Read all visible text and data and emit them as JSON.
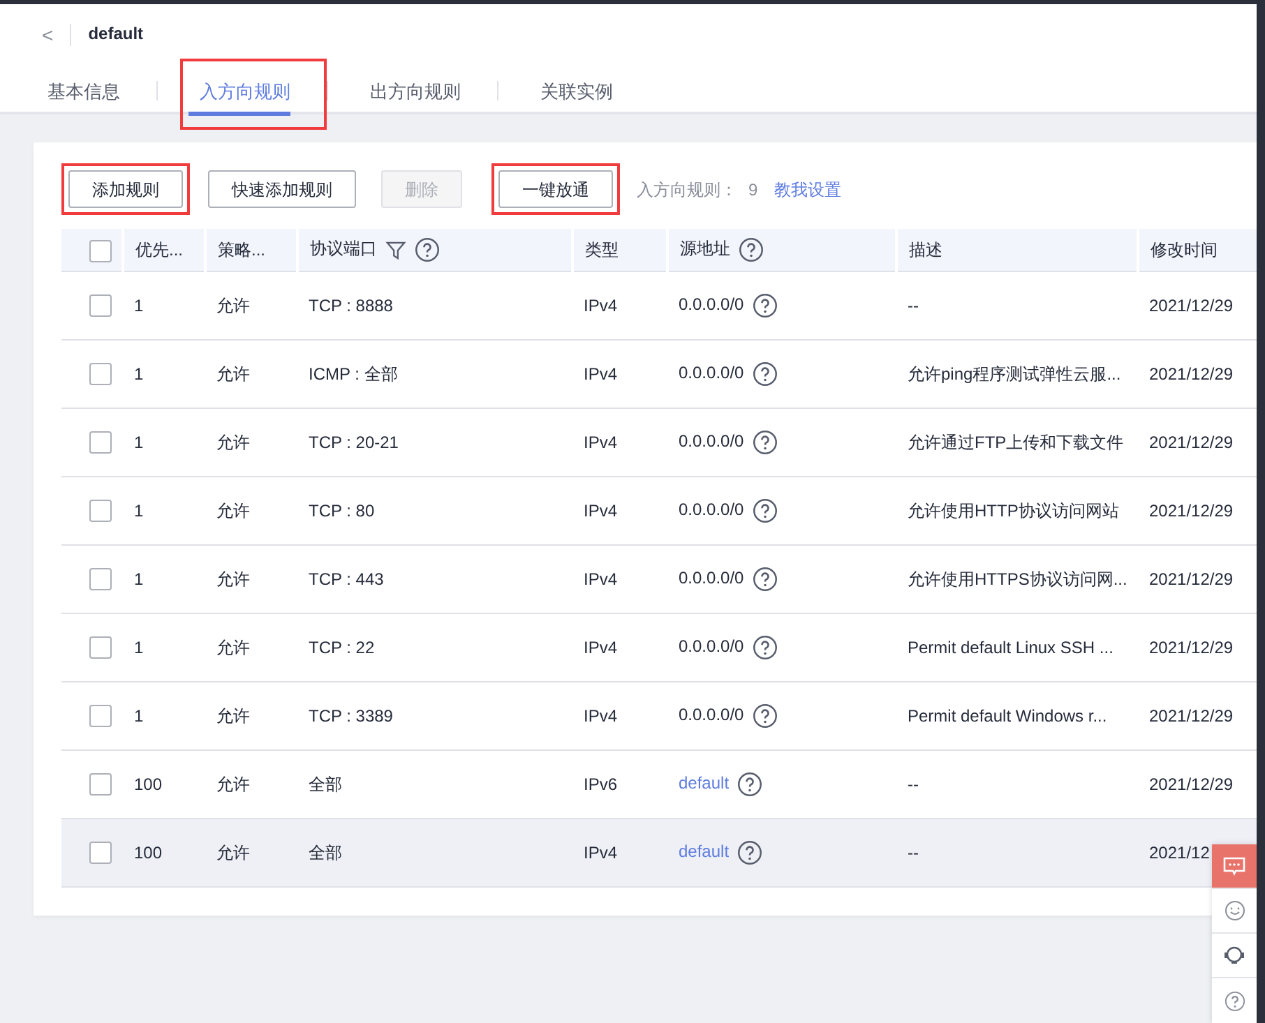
{
  "header": {
    "back": "<",
    "title": "default"
  },
  "tabs": [
    {
      "label": "基本信息",
      "selected": false,
      "highlighted": false
    },
    {
      "label": "入方向规则",
      "selected": true,
      "highlighted": true
    },
    {
      "label": "出方向规则",
      "selected": false,
      "highlighted": false
    },
    {
      "label": "关联实例",
      "selected": false,
      "highlighted": false
    }
  ],
  "toolbar": {
    "buttons": [
      {
        "label": "添加规则",
        "disabled": false,
        "highlighted": true
      },
      {
        "label": "快速添加规则",
        "disabled": false,
        "highlighted": false
      },
      {
        "label": "删除",
        "disabled": true,
        "highlighted": false
      },
      {
        "label": "一键放通",
        "disabled": false,
        "highlighted": true
      }
    ],
    "count_label": "入方向规则：",
    "count": "9",
    "help_link": "教我设置"
  },
  "table": {
    "select_all_checked": false,
    "columns": [
      {
        "label": "优先...",
        "filter": false,
        "help": false
      },
      {
        "label": "策略...",
        "filter": false,
        "help": false
      },
      {
        "label": "协议端口",
        "filter": true,
        "help": true
      },
      {
        "label": "类型",
        "filter": false,
        "help": false
      },
      {
        "label": "源地址",
        "filter": false,
        "help": true
      },
      {
        "label": "描述",
        "filter": false,
        "help": false
      },
      {
        "label": "修改时间",
        "filter": false,
        "help": false
      }
    ],
    "rows": [
      {
        "checked": false,
        "hover": false,
        "priority": "1",
        "action": "允许",
        "port": "TCP : 8888",
        "type": "IPv4",
        "source": "0.0.0.0/0",
        "source_link": false,
        "description": "--",
        "modified": "2021/12/29"
      },
      {
        "checked": false,
        "hover": false,
        "priority": "1",
        "action": "允许",
        "port": "ICMP : 全部",
        "type": "IPv4",
        "source": "0.0.0.0/0",
        "source_link": false,
        "description": "允许ping程序测试弹性云服...",
        "modified": "2021/12/29"
      },
      {
        "checked": false,
        "hover": false,
        "priority": "1",
        "action": "允许",
        "port": "TCP : 20-21",
        "type": "IPv4",
        "source": "0.0.0.0/0",
        "source_link": false,
        "description": "允许通过FTP上传和下载文件",
        "modified": "2021/12/29"
      },
      {
        "checked": false,
        "hover": false,
        "priority": "1",
        "action": "允许",
        "port": "TCP : 80",
        "type": "IPv4",
        "source": "0.0.0.0/0",
        "source_link": false,
        "description": "允许使用HTTP协议访问网站",
        "modified": "2021/12/29"
      },
      {
        "checked": false,
        "hover": false,
        "priority": "1",
        "action": "允许",
        "port": "TCP : 443",
        "type": "IPv4",
        "source": "0.0.0.0/0",
        "source_link": false,
        "description": "允许使用HTTPS协议访问网...",
        "modified": "2021/12/29"
      },
      {
        "checked": false,
        "hover": false,
        "priority": "1",
        "action": "允许",
        "port": "TCP : 22",
        "type": "IPv4",
        "source": "0.0.0.0/0",
        "source_link": false,
        "description": "Permit default Linux SSH ...",
        "modified": "2021/12/29"
      },
      {
        "checked": false,
        "hover": false,
        "priority": "1",
        "action": "允许",
        "port": "TCP : 3389",
        "type": "IPv4",
        "source": "0.0.0.0/0",
        "source_link": false,
        "description": "Permit default Windows r...",
        "modified": "2021/12/29"
      },
      {
        "checked": false,
        "hover": false,
        "priority": "100",
        "action": "允许",
        "port": "全部",
        "type": "IPv6",
        "source": "default",
        "source_link": true,
        "description": "--",
        "modified": "2021/12/29"
      },
      {
        "checked": false,
        "hover": true,
        "priority": "100",
        "action": "允许",
        "port": "全部",
        "type": "IPv4",
        "source": "default",
        "source_link": true,
        "description": "--",
        "modified": "2021/12"
      }
    ]
  }
}
